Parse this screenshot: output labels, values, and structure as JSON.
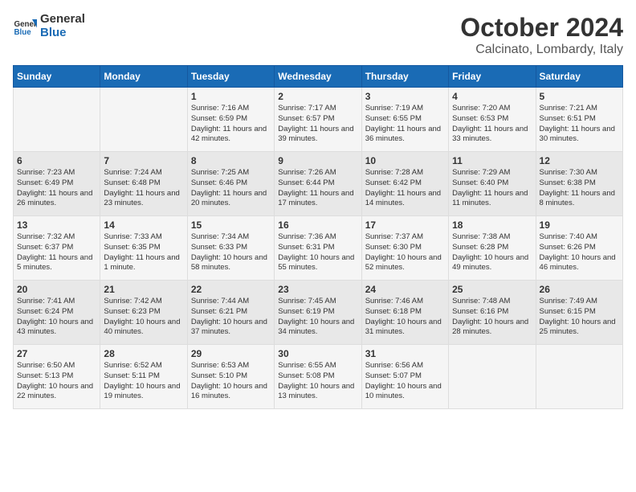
{
  "logo": {
    "general": "General",
    "blue": "Blue"
  },
  "title": {
    "month_year": "October 2024",
    "location": "Calcinato, Lombardy, Italy"
  },
  "calendar": {
    "days_of_week": [
      "Sunday",
      "Monday",
      "Tuesday",
      "Wednesday",
      "Thursday",
      "Friday",
      "Saturday"
    ],
    "weeks": [
      [
        {
          "day": "",
          "content": ""
        },
        {
          "day": "",
          "content": ""
        },
        {
          "day": "1",
          "content": "Sunrise: 7:16 AM\nSunset: 6:59 PM\nDaylight: 11 hours and 42 minutes."
        },
        {
          "day": "2",
          "content": "Sunrise: 7:17 AM\nSunset: 6:57 PM\nDaylight: 11 hours and 39 minutes."
        },
        {
          "day": "3",
          "content": "Sunrise: 7:19 AM\nSunset: 6:55 PM\nDaylight: 11 hours and 36 minutes."
        },
        {
          "day": "4",
          "content": "Sunrise: 7:20 AM\nSunset: 6:53 PM\nDaylight: 11 hours and 33 minutes."
        },
        {
          "day": "5",
          "content": "Sunrise: 7:21 AM\nSunset: 6:51 PM\nDaylight: 11 hours and 30 minutes."
        }
      ],
      [
        {
          "day": "6",
          "content": "Sunrise: 7:23 AM\nSunset: 6:49 PM\nDaylight: 11 hours and 26 minutes."
        },
        {
          "day": "7",
          "content": "Sunrise: 7:24 AM\nSunset: 6:48 PM\nDaylight: 11 hours and 23 minutes."
        },
        {
          "day": "8",
          "content": "Sunrise: 7:25 AM\nSunset: 6:46 PM\nDaylight: 11 hours and 20 minutes."
        },
        {
          "day": "9",
          "content": "Sunrise: 7:26 AM\nSunset: 6:44 PM\nDaylight: 11 hours and 17 minutes."
        },
        {
          "day": "10",
          "content": "Sunrise: 7:28 AM\nSunset: 6:42 PM\nDaylight: 11 hours and 14 minutes."
        },
        {
          "day": "11",
          "content": "Sunrise: 7:29 AM\nSunset: 6:40 PM\nDaylight: 11 hours and 11 minutes."
        },
        {
          "day": "12",
          "content": "Sunrise: 7:30 AM\nSunset: 6:38 PM\nDaylight: 11 hours and 8 minutes."
        }
      ],
      [
        {
          "day": "13",
          "content": "Sunrise: 7:32 AM\nSunset: 6:37 PM\nDaylight: 11 hours and 5 minutes."
        },
        {
          "day": "14",
          "content": "Sunrise: 7:33 AM\nSunset: 6:35 PM\nDaylight: 11 hours and 1 minute."
        },
        {
          "day": "15",
          "content": "Sunrise: 7:34 AM\nSunset: 6:33 PM\nDaylight: 10 hours and 58 minutes."
        },
        {
          "day": "16",
          "content": "Sunrise: 7:36 AM\nSunset: 6:31 PM\nDaylight: 10 hours and 55 minutes."
        },
        {
          "day": "17",
          "content": "Sunrise: 7:37 AM\nSunset: 6:30 PM\nDaylight: 10 hours and 52 minutes."
        },
        {
          "day": "18",
          "content": "Sunrise: 7:38 AM\nSunset: 6:28 PM\nDaylight: 10 hours and 49 minutes."
        },
        {
          "day": "19",
          "content": "Sunrise: 7:40 AM\nSunset: 6:26 PM\nDaylight: 10 hours and 46 minutes."
        }
      ],
      [
        {
          "day": "20",
          "content": "Sunrise: 7:41 AM\nSunset: 6:24 PM\nDaylight: 10 hours and 43 minutes."
        },
        {
          "day": "21",
          "content": "Sunrise: 7:42 AM\nSunset: 6:23 PM\nDaylight: 10 hours and 40 minutes."
        },
        {
          "day": "22",
          "content": "Sunrise: 7:44 AM\nSunset: 6:21 PM\nDaylight: 10 hours and 37 minutes."
        },
        {
          "day": "23",
          "content": "Sunrise: 7:45 AM\nSunset: 6:19 PM\nDaylight: 10 hours and 34 minutes."
        },
        {
          "day": "24",
          "content": "Sunrise: 7:46 AM\nSunset: 6:18 PM\nDaylight: 10 hours and 31 minutes."
        },
        {
          "day": "25",
          "content": "Sunrise: 7:48 AM\nSunset: 6:16 PM\nDaylight: 10 hours and 28 minutes."
        },
        {
          "day": "26",
          "content": "Sunrise: 7:49 AM\nSunset: 6:15 PM\nDaylight: 10 hours and 25 minutes."
        }
      ],
      [
        {
          "day": "27",
          "content": "Sunrise: 6:50 AM\nSunset: 5:13 PM\nDaylight: 10 hours and 22 minutes."
        },
        {
          "day": "28",
          "content": "Sunrise: 6:52 AM\nSunset: 5:11 PM\nDaylight: 10 hours and 19 minutes."
        },
        {
          "day": "29",
          "content": "Sunrise: 6:53 AM\nSunset: 5:10 PM\nDaylight: 10 hours and 16 minutes."
        },
        {
          "day": "30",
          "content": "Sunrise: 6:55 AM\nSunset: 5:08 PM\nDaylight: 10 hours and 13 minutes."
        },
        {
          "day": "31",
          "content": "Sunrise: 6:56 AM\nSunset: 5:07 PM\nDaylight: 10 hours and 10 minutes."
        },
        {
          "day": "",
          "content": ""
        },
        {
          "day": "",
          "content": ""
        }
      ]
    ]
  }
}
